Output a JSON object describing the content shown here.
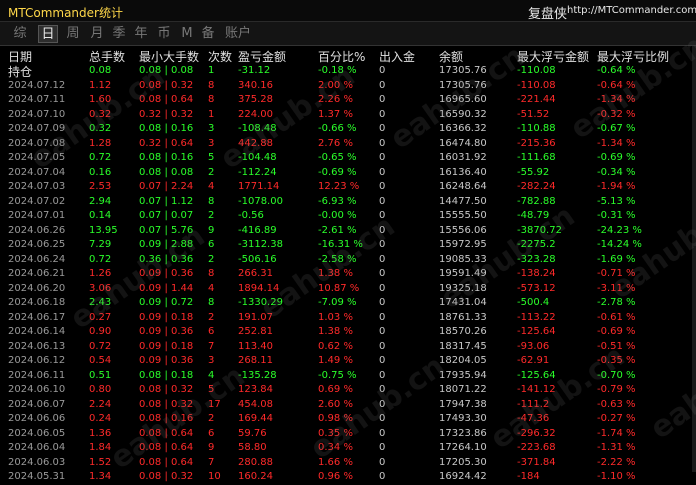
{
  "app": {
    "title": "MTCommander统计",
    "copy_label": "复盘侠",
    "site": "http://MTCommander.com"
  },
  "tabs": [
    "综",
    "日",
    "周",
    "月",
    "季",
    "年",
    "币",
    "M",
    "备",
    "账户"
  ],
  "active_tab": 1,
  "columns": [
    "日期",
    "总手数",
    "最小大手数",
    "次数",
    "盈亏金额",
    "百分比%",
    "出入金",
    "余额",
    "最大浮亏金额",
    "最大浮亏比例"
  ],
  "summary_label": "持仓",
  "summary": [
    "0.08",
    "0.08 | 0.08",
    "1",
    "-31.12",
    "-0.18 %",
    "0",
    "17305.76",
    "-110.08",
    "-0.64 %"
  ],
  "rows": [
    {
      "d": "2024.07.12",
      "v": [
        "1.12",
        "0.08 | 0.32",
        "8",
        "340.16",
        "2.00 %",
        "0",
        "17305.76",
        "-110.08",
        "-0.64 %"
      ],
      "t": "up"
    },
    {
      "d": "2024.07.11",
      "v": [
        "1.60",
        "0.08 | 0.64",
        "8",
        "375.28",
        "2.26 %",
        "0",
        "16965.60",
        "-221.44",
        "-1.34 %"
      ],
      "t": "up"
    },
    {
      "d": "2024.07.10",
      "v": [
        "0.32",
        "0.32 | 0.32",
        "1",
        "224.00",
        "1.37 %",
        "0",
        "16590.32",
        "-51.52",
        "-0.32 %"
      ],
      "t": "up"
    },
    {
      "d": "2024.07.09",
      "v": [
        "0.32",
        "0.08 | 0.16",
        "3",
        "-108.48",
        "-0.66 %",
        "0",
        "16366.32",
        "-110.88",
        "-0.67 %"
      ],
      "t": "down"
    },
    {
      "d": "2024.07.08",
      "v": [
        "1.28",
        "0.32 | 0.64",
        "3",
        "442.88",
        "2.76 %",
        "0",
        "16474.80",
        "-215.36",
        "-1.34 %"
      ],
      "t": "up"
    },
    {
      "d": "2024.07.05",
      "v": [
        "0.72",
        "0.08 | 0.16",
        "5",
        "-104.48",
        "-0.65 %",
        "0",
        "16031.92",
        "-111.68",
        "-0.69 %"
      ],
      "t": "down"
    },
    {
      "d": "2024.07.04",
      "v": [
        "0.16",
        "0.08 | 0.08",
        "2",
        "-112.24",
        "-0.69 %",
        "0",
        "16136.40",
        "-55.92",
        "-0.34 %"
      ],
      "t": "down"
    },
    {
      "d": "2024.07.03",
      "v": [
        "2.53",
        "0.07 | 2.24",
        "4",
        "1771.14",
        "12.23 %",
        "0",
        "16248.64",
        "-282.24",
        "-1.94 %"
      ],
      "t": "up"
    },
    {
      "d": "2024.07.02",
      "v": [
        "2.94",
        "0.07 | 1.12",
        "8",
        "-1078.00",
        "-6.93 %",
        "0",
        "14477.50",
        "-782.88",
        "-5.13 %"
      ],
      "t": "down"
    },
    {
      "d": "2024.07.01",
      "v": [
        "0.14",
        "0.07 | 0.07",
        "2",
        "-0.56",
        "-0.00 %",
        "0",
        "15555.50",
        "-48.79",
        "-0.31 %"
      ],
      "t": "down"
    },
    {
      "d": "2024.06.26",
      "v": [
        "13.95",
        "0.07 | 5.76",
        "9",
        "-416.89",
        "-2.61 %",
        "0",
        "15556.06",
        "-3870.72",
        "-24.23 %"
      ],
      "t": "down"
    },
    {
      "d": "2024.06.25",
      "v": [
        "7.29",
        "0.09 | 2.88",
        "6",
        "-3112.38",
        "-16.31 %",
        "0",
        "15972.95",
        "-2275.2",
        "-14.24 %"
      ],
      "t": "down"
    },
    {
      "d": "2024.06.24",
      "v": [
        "0.72",
        "0.36 | 0.36",
        "2",
        "-506.16",
        "-2.58 %",
        "0",
        "19085.33",
        "-323.28",
        "-1.69 %"
      ],
      "t": "down"
    },
    {
      "d": "2024.06.21",
      "v": [
        "1.26",
        "0.09 | 0.36",
        "8",
        "266.31",
        "1.38 %",
        "0",
        "19591.49",
        "-138.24",
        "-0.71 %"
      ],
      "t": "up"
    },
    {
      "d": "2024.06.20",
      "v": [
        "3.06",
        "0.09 | 1.44",
        "4",
        "1894.14",
        "10.87 %",
        "0",
        "19325.18",
        "-573.12",
        "-3.11 %"
      ],
      "t": "up"
    },
    {
      "d": "2024.06.18",
      "v": [
        "2.43",
        "0.09 | 0.72",
        "8",
        "-1330.29",
        "-7.09 %",
        "0",
        "17431.04",
        "-500.4",
        "-2.78 %"
      ],
      "t": "down"
    },
    {
      "d": "2024.06.17",
      "v": [
        "0.27",
        "0.09 | 0.18",
        "2",
        "191.07",
        "1.03 %",
        "0",
        "18761.33",
        "-113.22",
        "-0.61 %"
      ],
      "t": "up"
    },
    {
      "d": "2024.06.14",
      "v": [
        "0.90",
        "0.09 | 0.36",
        "6",
        "252.81",
        "1.38 %",
        "0",
        "18570.26",
        "-125.64",
        "-0.69 %"
      ],
      "t": "up"
    },
    {
      "d": "2024.06.13",
      "v": [
        "0.72",
        "0.09 | 0.18",
        "7",
        "113.40",
        "0.62 %",
        "0",
        "18317.45",
        "-93.06",
        "-0.51 %"
      ],
      "t": "up"
    },
    {
      "d": "2024.06.12",
      "v": [
        "0.54",
        "0.09 | 0.36",
        "3",
        "268.11",
        "1.49 %",
        "0",
        "18204.05",
        "-62.91",
        "-0.35 %"
      ],
      "t": "up"
    },
    {
      "d": "2024.06.11",
      "v": [
        "0.51",
        "0.08 | 0.18",
        "4",
        "-135.28",
        "-0.75 %",
        "0",
        "17935.94",
        "-125.64",
        "-0.70 %"
      ],
      "t": "down"
    },
    {
      "d": "2024.06.10",
      "v": [
        "0.80",
        "0.08 | 0.32",
        "5",
        "123.84",
        "0.69 %",
        "0",
        "18071.22",
        "-141.12",
        "-0.79 %"
      ],
      "t": "up"
    },
    {
      "d": "2024.06.07",
      "v": [
        "2.24",
        "0.08 | 0.32",
        "17",
        "454.08",
        "2.60 %",
        "0",
        "17947.38",
        "-111.2",
        "-0.63 %"
      ],
      "t": "up"
    },
    {
      "d": "2024.06.06",
      "v": [
        "0.24",
        "0.08 | 0.16",
        "2",
        "169.44",
        "0.98 %",
        "0",
        "17493.30",
        "-47.36",
        "-0.27 %"
      ],
      "t": "up"
    },
    {
      "d": "2024.06.05",
      "v": [
        "1.36",
        "0.08 | 0.64",
        "6",
        "59.76",
        "0.35 %",
        "0",
        "17323.86",
        "-296.32",
        "-1.74 %"
      ],
      "t": "up"
    },
    {
      "d": "2024.06.04",
      "v": [
        "1.84",
        "0.08 | 0.64",
        "9",
        "58.80",
        "0.34 %",
        "0",
        "17264.10",
        "-223.68",
        "-1.31 %"
      ],
      "t": "up"
    },
    {
      "d": "2024.06.03",
      "v": [
        "1.52",
        "0.08 | 0.64",
        "7",
        "280.88",
        "1.66 %",
        "0",
        "17205.30",
        "-371.84",
        "-2.22 %"
      ],
      "t": "up"
    },
    {
      "d": "2024.05.31",
      "v": [
        "1.34",
        "0.08 | 0.32",
        "10",
        "160.24",
        "0.96 %",
        "0",
        "16924.42",
        "-184",
        "-1.10 %"
      ],
      "t": "up"
    }
  ],
  "watermark_text": "eahub.cn"
}
